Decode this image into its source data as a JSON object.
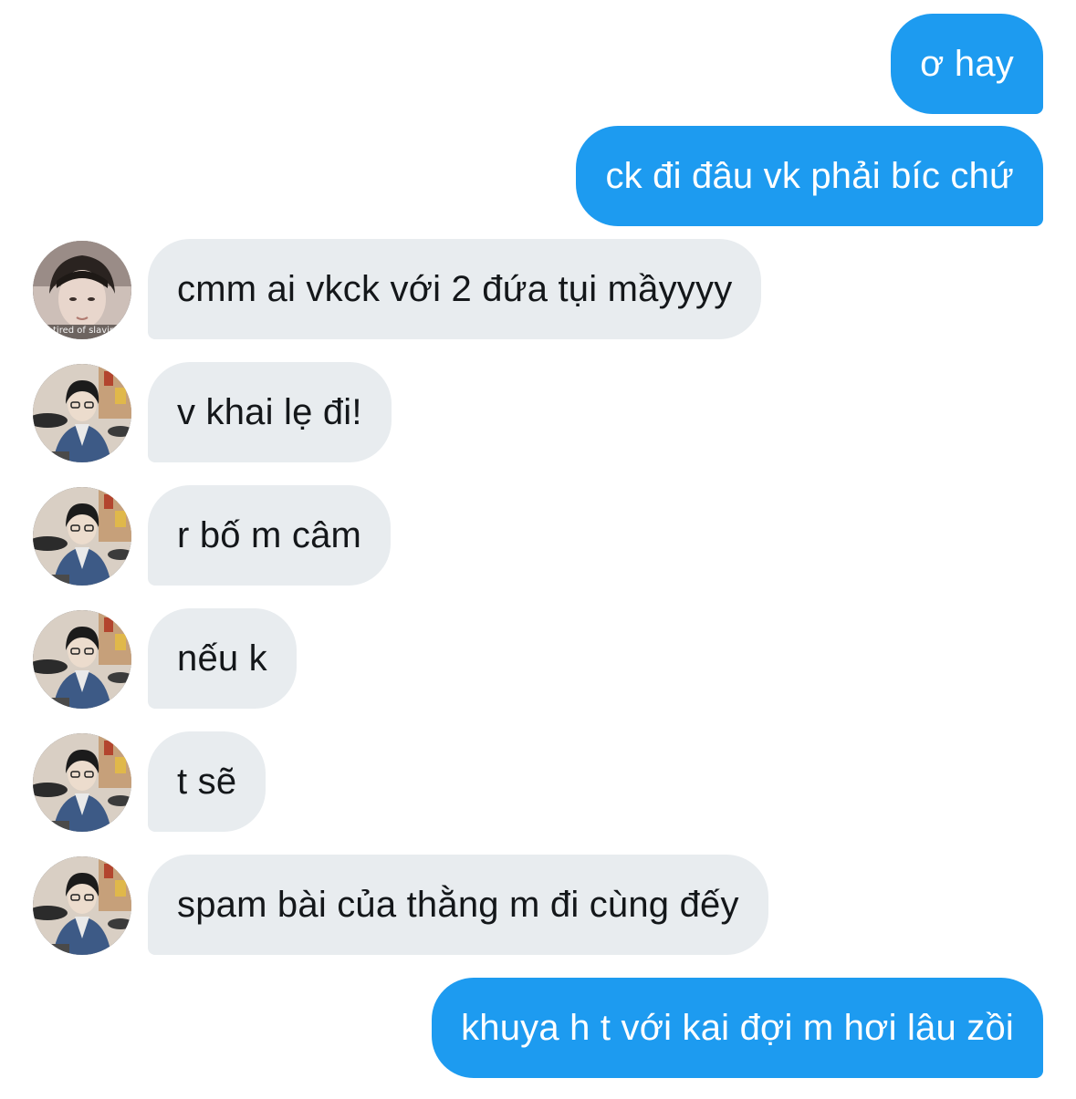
{
  "conversation": {
    "messages": [
      {
        "direction": "outgoing",
        "text": "ơ hay"
      },
      {
        "direction": "outgoing",
        "text": "ck đi đâu vk phải bíc chứ"
      },
      {
        "direction": "incoming",
        "text": "cmm ai vkck với 2 đứa tụi mầyyyy",
        "avatar": "avatar-photo-1",
        "avatar_caption": "tired of slaving"
      },
      {
        "direction": "incoming",
        "text": "v khai lẹ đi!",
        "avatar": "avatar-photo-2"
      },
      {
        "direction": "incoming",
        "text": "r bố m câm",
        "avatar": "avatar-photo-2"
      },
      {
        "direction": "incoming",
        "text": "nếu k",
        "avatar": "avatar-photo-2"
      },
      {
        "direction": "incoming",
        "text": "t sẽ",
        "avatar": "avatar-photo-2"
      },
      {
        "direction": "incoming",
        "text": "spam bài của thằng m đi cùng đếy",
        "avatar": "avatar-photo-2"
      },
      {
        "direction": "outgoing",
        "text": "khuya h t với kai đợi m hơi lâu zồi"
      }
    ]
  },
  "colors": {
    "outgoing_bubble": "#1d9bf0",
    "incoming_bubble": "#e8ecef",
    "outgoing_text": "#ffffff",
    "incoming_text": "#14171a",
    "background": "#ffffff"
  }
}
